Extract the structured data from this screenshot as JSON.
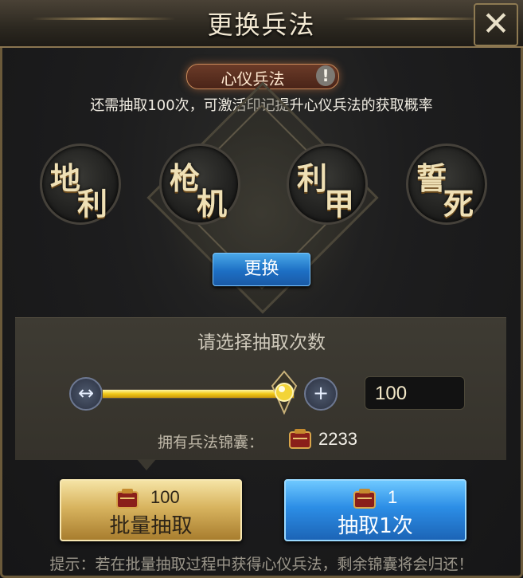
{
  "window": {
    "title": "更换兵法",
    "close_glyph": "✕"
  },
  "tactic": {
    "heart_label": "心仪兵法",
    "info_glyph": "!",
    "hint": "还需抽取100次，可激活印记提升心仪兵法的获取概率"
  },
  "medals": [
    {
      "char1": "地",
      "char2": "利"
    },
    {
      "char1": "枪",
      "char2": "机"
    },
    {
      "char1": "利",
      "char2": "甲"
    },
    {
      "char1": "誓",
      "char2": "死"
    }
  ],
  "change_button": "更换",
  "draw": {
    "title": "请选择抽取次数",
    "minus_glyph": "↔",
    "plus_glyph": "+",
    "slider_fraction": 1.0,
    "quantity": "100",
    "own_label": "拥有兵法锦囊：",
    "own_value": "2233",
    "bag_icon": "brocade-bag-icon"
  },
  "buttons": {
    "batch_count": "100",
    "batch_label": "批量抽取",
    "once_count": "1",
    "once_label": "抽取1次"
  },
  "footer": "提示：若在批量抽取过程中获得心仪兵法，剩余锦囊将会归还！",
  "colors": {
    "gold": "#d8b45f",
    "blue": "#2c8ee6",
    "slider": "#f0c818"
  }
}
